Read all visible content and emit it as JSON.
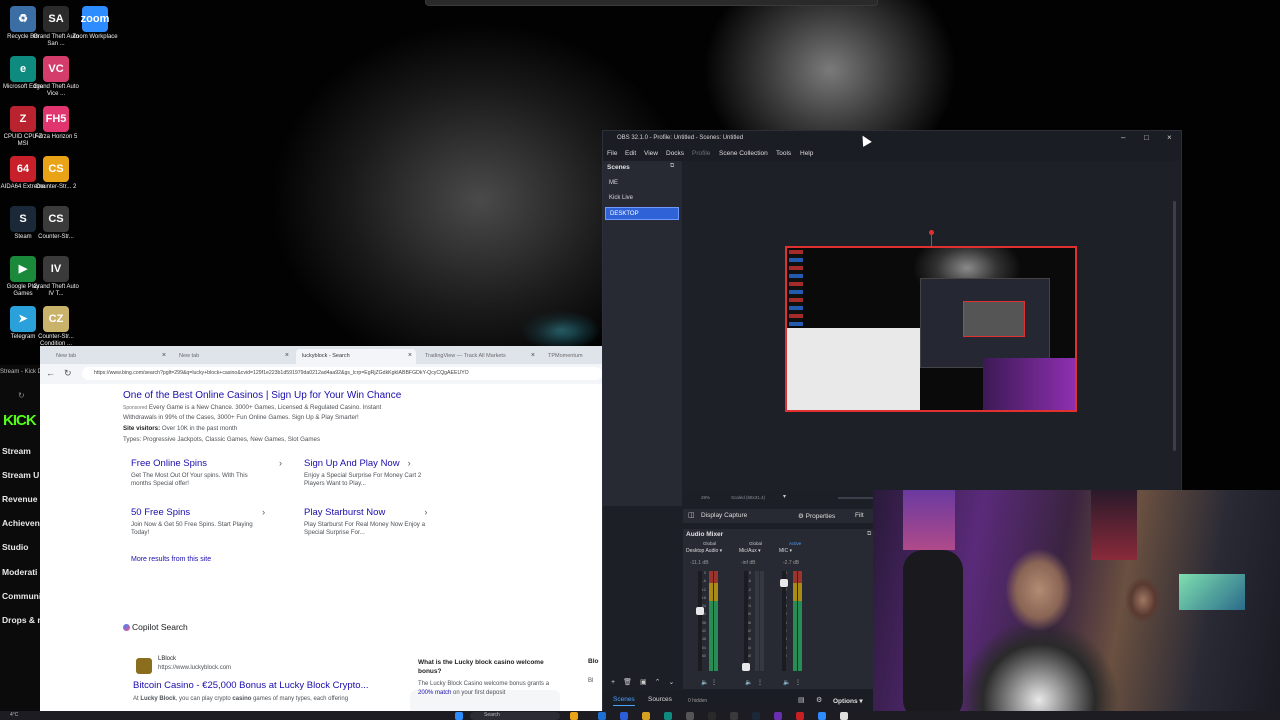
{
  "desktop": {
    "icons": [
      {
        "label": "Recycle Bin",
        "glyph": "♻",
        "color": "#3a6ea5"
      },
      {
        "label": "Grand Theft Auto San ...",
        "glyph": "SA",
        "color": "#2b2b2b"
      },
      {
        "label": "Zoom Workplace",
        "glyph": "zoom",
        "color": "#2d8cff"
      },
      {
        "label": "Microsoft Edge",
        "glyph": "e",
        "color": "#0f8a7e"
      },
      {
        "label": "Grand Theft Auto Vice ...",
        "glyph": "VC",
        "color": "#d43c6c"
      },
      {
        "label": "CPUID CPU-Z MSI",
        "glyph": "Z",
        "color": "#b8232f"
      },
      {
        "label": "Forza Horizon 5",
        "glyph": "FH5",
        "color": "#e0356e"
      },
      {
        "label": "AIDA64 Extreme",
        "glyph": "64",
        "color": "#c8202a"
      },
      {
        "label": "Counter-Str... 2",
        "glyph": "CS",
        "color": "#e8a317"
      },
      {
        "label": "Steam",
        "glyph": "S",
        "color": "#1b2838"
      },
      {
        "label": "Counter-Str...",
        "glyph": "CS",
        "color": "#3b3b3b"
      },
      {
        "label": "Google Play Games",
        "glyph": "▶",
        "color": "#1a8a3a"
      },
      {
        "label": "Grand Theft Auto IV T...",
        "glyph": "IV",
        "color": "#3a3a3a"
      },
      {
        "label": "Telegram",
        "glyph": "➤",
        "color": "#2aa1da"
      },
      {
        "label": "Counter-Str... Condition ...",
        "glyph": "CZ",
        "color": "#c9b26a"
      }
    ]
  },
  "kick": {
    "tab_label": "Stream - Kick Da",
    "logo": "KICK",
    "nav": [
      "Stream",
      "Stream U",
      "Revenue",
      "Achieven",
      "Studio",
      "Moderati",
      "Communi",
      "Drops & r"
    ]
  },
  "browser": {
    "tabs": [
      {
        "label": "New tab"
      },
      {
        "label": "New tab"
      },
      {
        "label": "luckyblock - Search"
      },
      {
        "label": "TradingView — Track All Markets"
      },
      {
        "label": "TPMomentum"
      }
    ],
    "url": "https://www.bing.com/search?pglt=299&q=lucky+block+casino&cvid=129f1e223b1d591979da0212ad4aa92&gs_lcrp=EgRjZGdkKgkIABBFGDkY-QcyCQgAEEUYO",
    "ad": {
      "title": "One of the Best Online Casinos | Sign Up for Your Win Chance",
      "line1_sponsored": "Sponsored",
      "line1": "Every Game is a New Chance. 3000+ Games, Licensed & Regulated Casino. Instant",
      "line2": "Withdrawals in 99% of the Cases, 3000+ Fun Online Games. Sign Up & Play Smarter!",
      "visitors_label": "Site visitors:",
      "visitors_value": "Over 10K in the past month",
      "types": "Types: Progressive Jackpots, Classic Games, New Games, Slot Games"
    },
    "sitelinks": [
      {
        "title": "Free Online Spins",
        "desc": "Get The Most Out Of Your spins. With This months Special offer!"
      },
      {
        "title": "Sign Up And Play Now",
        "desc": "Enjoy a Special Surprise For Money Cart 2 Players Want to Play..."
      },
      {
        "title": "50 Free Spins",
        "desc": "Join Now & Get 50 Free Spins. Start Playing Today!"
      },
      {
        "title": "Play Starburst Now",
        "desc": "Play Starburst For Real Money Now Enjoy a Special Surprise For..."
      }
    ],
    "more_results": "More results from this site",
    "copilot_label": "Copilot Search",
    "result": {
      "site_name": "LBlock",
      "site_url": "https://www.luckyblock.com",
      "title": "Bitcoin Casino - €25,000 Bonus at Lucky Block Crypto...",
      "snippet_pre": "At",
      "snippet_bold": "Lucky Block",
      "snippet_mid": ", you can play crypto",
      "snippet_bold2": "casino",
      "snippet_post": "games of many types, each offering"
    },
    "faq": {
      "question": "What is the Lucky block casino welcome bonus?",
      "answer_pre": "The Lucky Block Casino welcome bonus grants a",
      "answer_link": "200% match",
      "answer_post": "on your first deposit"
    },
    "side_card": {
      "title": "Blo",
      "text": "Bl"
    }
  },
  "obs": {
    "title": "OBS 32.1.0 - Profile: Untitled - Scenes: Untitled",
    "menu": [
      "File",
      "Edit",
      "View",
      "Docks",
      "Profile",
      "Scene Collection",
      "Tools",
      "Help"
    ],
    "scenes_header": "Scenes",
    "scenes": [
      "ME",
      "Kick Live",
      "DESKTOP"
    ],
    "selected_scene": "DESKTOP",
    "zoom_readout": "28%",
    "scale_readout": "Scaled (68x31.4)",
    "source_label": "Display Capture",
    "properties_label": "Properties",
    "filters_label": "Filt",
    "mixer_header": "Audio Mixer",
    "channels": [
      {
        "tag": "Global",
        "name": "Desktop Audio",
        "db": "-11.1 dB",
        "tag_active": false
      },
      {
        "tag": "Global",
        "name": "Mic/Aux",
        "db": "-inf dB",
        "tag_active": false
      },
      {
        "tag": "Active",
        "name": "MIC",
        "db": "-2.7 dB",
        "tag_active": true
      }
    ],
    "meter_scale": [
      "0",
      "-6",
      "-12",
      "-18",
      "-24",
      "-30",
      "-36",
      "-42",
      "-48",
      "-54",
      "-60"
    ],
    "dock_tabs": [
      "Scenes",
      "Sources"
    ],
    "hidden_count": "0 hidden",
    "options_label": "Options"
  },
  "taskbar": {
    "search_placeholder": "Search",
    "tray_text": "4°C"
  },
  "colors": {
    "obs_selection": "#2f62d6",
    "preview_border": "#e03030",
    "kick_green": "#53fc18",
    "link_blue": "#1a0dab"
  }
}
